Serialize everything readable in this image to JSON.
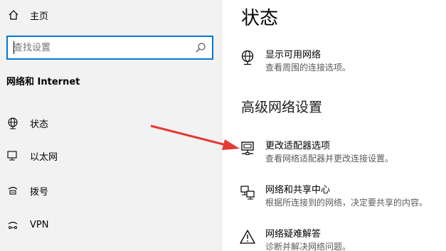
{
  "sidebar": {
    "home_label": "主页",
    "search_placeholder": "查找设置",
    "section_title": "网络和 Internet",
    "items": [
      {
        "label": "状态",
        "icon": "globe-status-icon"
      },
      {
        "label": "以太网",
        "icon": "ethernet-icon"
      },
      {
        "label": "拨号",
        "icon": "dialup-icon"
      },
      {
        "label": "VPN",
        "icon": "vpn-icon"
      }
    ]
  },
  "main": {
    "title": "状态",
    "show_networks": {
      "title": "显示可用网络",
      "desc": "查看周围的连接选项。"
    },
    "advanced_title": "高级网络设置",
    "options": [
      {
        "title": "更改适配器选项",
        "desc": "查看网络适配器并更改连接设置。",
        "icon": "adapter-icon"
      },
      {
        "title": "网络和共享中心",
        "desc": "根据所连接到的网络，决定要共享的内容。",
        "icon": "sharing-center-icon"
      },
      {
        "title": "网络疑难解答",
        "desc": "诊断并解决网络问题。",
        "icon": "warning-icon"
      }
    ]
  },
  "colors": {
    "accent": "#0078d7",
    "arrow": "#e53935",
    "sidebar_bg": "#f2f2f2"
  }
}
